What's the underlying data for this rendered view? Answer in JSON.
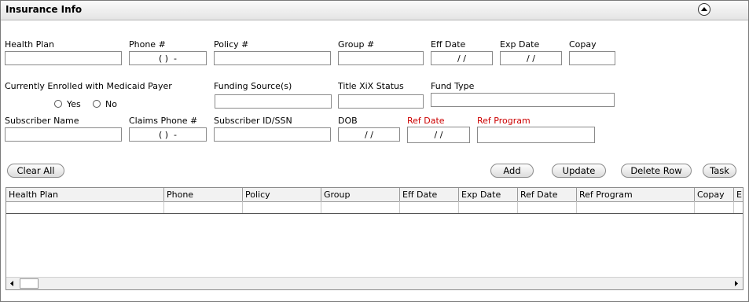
{
  "section": {
    "title": "Insurance Info",
    "collapse_icon": "chevron-up-circle-icon"
  },
  "form": {
    "health_plan": {
      "label": "Health Plan",
      "value": ""
    },
    "phone": {
      "label": "Phone #",
      "value": "( )  -"
    },
    "policy": {
      "label": "Policy #",
      "value": ""
    },
    "group": {
      "label": "Group #",
      "value": ""
    },
    "eff_date": {
      "label": "Eff Date",
      "value": "/ /"
    },
    "exp_date": {
      "label": "Exp Date",
      "value": "/ /"
    },
    "copay": {
      "label": "Copay",
      "value": ""
    },
    "medicaid": {
      "label": "Currently Enrolled with Medicaid Payer",
      "yes": "Yes",
      "no": "No"
    },
    "funding_source": {
      "label": "Funding Source(s)",
      "value": ""
    },
    "title_xix": {
      "label": "Title XiX Status",
      "value": ""
    },
    "fund_type": {
      "label": "Fund Type",
      "value": ""
    },
    "subscriber_name": {
      "label": "Subscriber Name",
      "value": ""
    },
    "claims_phone": {
      "label": "Claims Phone #",
      "value": "( )  -"
    },
    "subscriber_id": {
      "label": "Subscriber ID/SSN",
      "value": ""
    },
    "dob": {
      "label": "DOB",
      "value": "/ /"
    },
    "ref_date": {
      "label": "Ref Date",
      "value": "/ /",
      "color": "#cc0000"
    },
    "ref_program": {
      "label": "Ref Program",
      "value": "",
      "color": "#cc0000"
    }
  },
  "buttons": {
    "clear_all": "Clear All",
    "add": "Add",
    "update": "Update",
    "delete_row": "Delete Row",
    "task": "Task"
  },
  "grid": {
    "columns": [
      "Health Plan",
      "Phone",
      "Policy",
      "Group",
      "Eff Date",
      "Exp Date",
      "Ref Date",
      "Ref Program",
      "Copay",
      "E"
    ],
    "rows": []
  }
}
